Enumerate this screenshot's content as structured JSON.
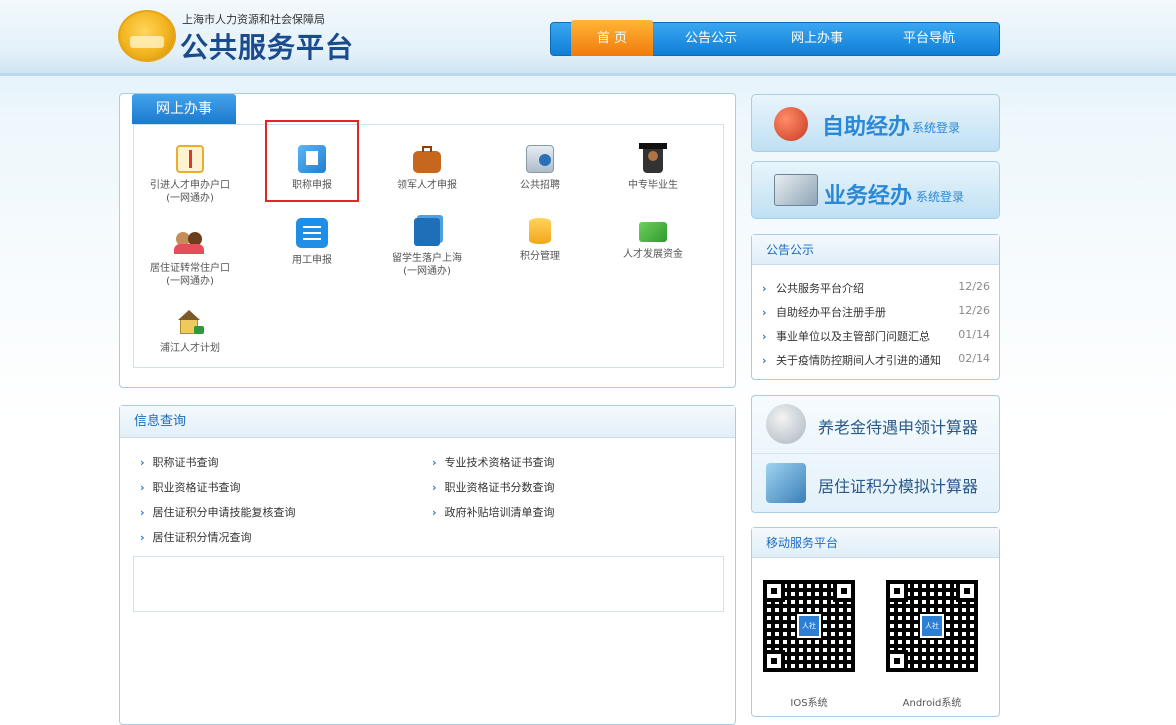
{
  "header": {
    "org_name": "上海市人力资源和社会保障局",
    "platform_name": "公共服务平台",
    "nav": [
      {
        "label": "首 页",
        "active": true
      },
      {
        "label": "公告公示",
        "active": false
      },
      {
        "label": "网上办事",
        "active": false
      },
      {
        "label": "平台导航",
        "active": false
      }
    ]
  },
  "online_services": {
    "tab_label": "网上办事",
    "items": [
      {
        "label": "引进人才申办户口\n(一网通办)",
        "icon": "document-certificate-icon"
      },
      {
        "label": "职称申报",
        "icon": "edit-form-icon",
        "highlighted": true
      },
      {
        "label": "领军人才申报",
        "icon": "briefcase-icon"
      },
      {
        "label": "公共招聘",
        "icon": "recruit-card-icon"
      },
      {
        "label": "中专毕业生",
        "icon": "graduate-icon"
      },
      {
        "label": "用工申报",
        "icon": "list-document-icon"
      },
      {
        "label": "留学生落户上海\n(一网通办)",
        "icon": "files-stack-icon"
      },
      {
        "label": "积分管理",
        "icon": "database-icon"
      },
      {
        "label": "人才发展资金",
        "icon": "money-icon"
      },
      {
        "label": "居住证转常住户口\n(一网通办)",
        "icon": "people-icon"
      },
      {
        "label": "浦江人才计划",
        "icon": "house-arrow-icon"
      }
    ]
  },
  "info_query": {
    "title": "信息查询",
    "left_links": [
      "职称证书查询",
      "职业资格证书查询",
      "居住证积分申请技能复核查询",
      "居住证积分情况查询"
    ],
    "right_links": [
      "专业技术资格证书查询",
      "职业资格证书分数查询",
      "政府补贴培训清单查询"
    ]
  },
  "banners": {
    "self_service": {
      "main": "自助经办",
      "sub": "系统登录"
    },
    "business_service": {
      "main": "业务经办",
      "sub": "系统登录"
    }
  },
  "notices": {
    "title": "公告公示",
    "rows": [
      {
        "text": "公共服务平台介绍",
        "date": "12/26"
      },
      {
        "text": "自助经办平台注册手册",
        "date": "12/26"
      },
      {
        "text": "事业单位以及主管部门问题汇总",
        "date": "01/14"
      },
      {
        "text": "关于疫情防控期间人才引进的通知",
        "date": "02/14"
      }
    ]
  },
  "calculators": [
    {
      "label": "养老金待遇申领计算器",
      "icon": "elderly-person-icon"
    },
    {
      "label": "居住证积分模拟计算器",
      "icon": "building-calculator-icon"
    }
  ],
  "mobile": {
    "title": "移动服务平台",
    "qr_center": "人社",
    "ios_label": "IOS系统",
    "android_label": "Android系统"
  }
}
